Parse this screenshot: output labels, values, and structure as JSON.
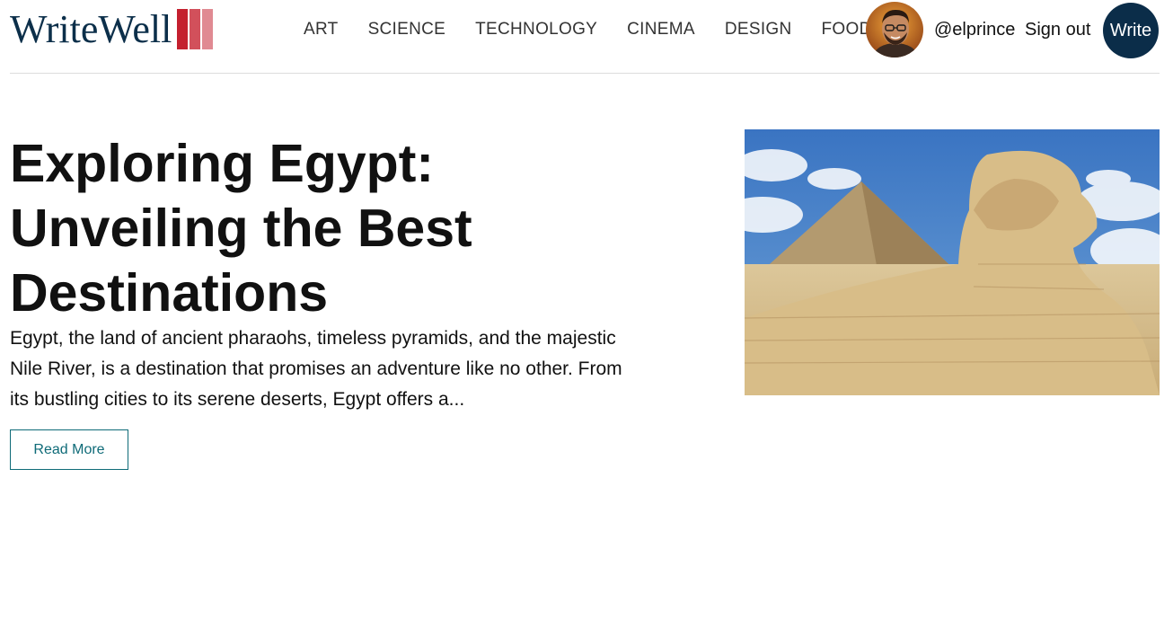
{
  "brand": {
    "name": "WriteWell",
    "colors": {
      "text": "#0c2f4a",
      "bar1": "#c4202f",
      "bar2": "#d2505b",
      "bar3": "#e08a92"
    }
  },
  "nav": {
    "items": [
      {
        "label": "ART"
      },
      {
        "label": "SCIENCE"
      },
      {
        "label": "TECHNOLOGY"
      },
      {
        "label": "CINEMA"
      },
      {
        "label": "DESIGN"
      },
      {
        "label": "FOOD"
      }
    ]
  },
  "user": {
    "username": "@elprince",
    "sign_out_label": "Sign out",
    "write_label": "Write"
  },
  "post": {
    "title": "Exploring Egypt: Unveiling the Best Destinations",
    "excerpt": "Egypt, the land of ancient pharaohs, timeless pyramids, and the majestic Nile River, is a destination that promises an adventure like no other. From its bustling cities to its serene deserts, Egypt offers a...",
    "read_more_label": "Read More",
    "image_icon": "pyramid-sphinx-photo"
  },
  "colors": {
    "accent": "#0f6b78",
    "write_button": "#0b2d49",
    "divider": "#dddddd"
  }
}
